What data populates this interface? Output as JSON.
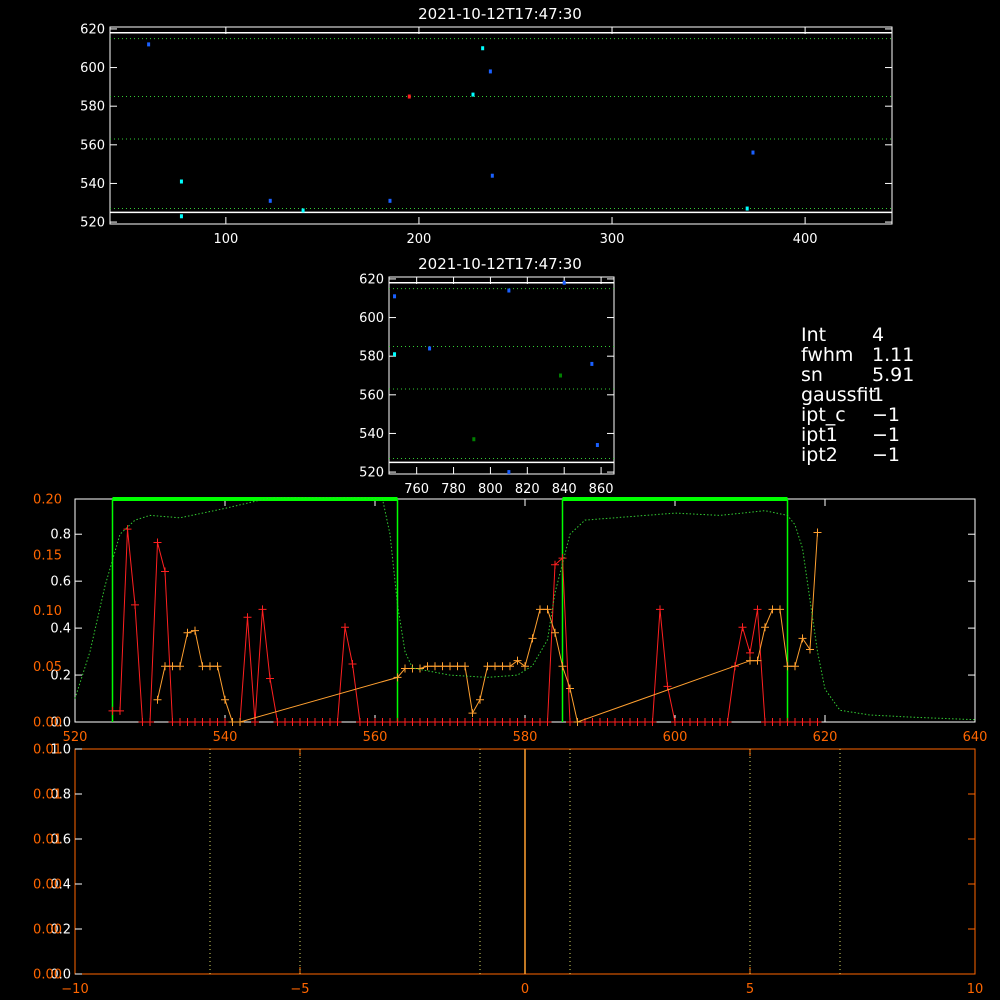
{
  "colors": {
    "background": "#000000",
    "axis": "#ffffff",
    "accent_green": "#00ff00",
    "red": "#ff2020",
    "orange": "#ffa030",
    "cyan": "#00ffff",
    "blue": "#1a60ff",
    "grid_green": "#33cc33",
    "orange_axis": "#ff6600"
  },
  "info": [
    {
      "key": "Int",
      "value": "4"
    },
    {
      "key": "fwhm",
      "value": "1.11"
    },
    {
      "key": "sn",
      "value": "5.91"
    },
    {
      "key": "gaussfit",
      "value": "1"
    },
    {
      "key": "ipt_c",
      "value": "−1"
    },
    {
      "key": "ipt1",
      "value": "−1"
    },
    {
      "key": "ipt2",
      "value": "−1"
    }
  ],
  "chart_data": [
    {
      "type": "scatter",
      "title": "2021-10-12T17:47:30",
      "xlim": [
        40,
        445
      ],
      "ylim": [
        519,
        621
      ],
      "xticks": [
        100,
        200,
        300,
        400
      ],
      "yticks": [
        520,
        540,
        560,
        580,
        600,
        620
      ],
      "hlines_white": [
        618,
        525
      ],
      "hlines_dotted": [
        615,
        585,
        563,
        527
      ],
      "points": [
        {
          "x": 60,
          "y": 612,
          "c": "blue"
        },
        {
          "x": 77,
          "y": 541,
          "c": "cyan"
        },
        {
          "x": 77,
          "y": 523,
          "c": "cyan"
        },
        {
          "x": 123,
          "y": 531,
          "c": "blue"
        },
        {
          "x": 140,
          "y": 526,
          "c": "cyan"
        },
        {
          "x": 185,
          "y": 531,
          "c": "blue"
        },
        {
          "x": 195,
          "y": 585,
          "c": "red"
        },
        {
          "x": 228,
          "y": 586,
          "c": "cyan"
        },
        {
          "x": 233,
          "y": 610,
          "c": "cyan"
        },
        {
          "x": 237,
          "y": 598,
          "c": "blue"
        },
        {
          "x": 238,
          "y": 544,
          "c": "blue"
        },
        {
          "x": 370,
          "y": 527,
          "c": "cyan"
        },
        {
          "x": 373,
          "y": 556,
          "c": "blue"
        }
      ]
    },
    {
      "type": "scatter",
      "title": "2021-10-12T17:47:30",
      "xlim": [
        745,
        867
      ],
      "ylim": [
        519,
        621
      ],
      "xticks": [
        760,
        780,
        800,
        820,
        840,
        860
      ],
      "yticks": [
        520,
        540,
        560,
        580,
        600,
        620
      ],
      "hlines_white": [
        618,
        525
      ],
      "hlines_dotted": [
        615,
        585,
        563,
        527
      ],
      "points": [
        {
          "x": 748,
          "y": 611,
          "c": "blue"
        },
        {
          "x": 748,
          "y": 581,
          "c": "cyan"
        },
        {
          "x": 767,
          "y": 584,
          "c": "blue"
        },
        {
          "x": 791,
          "y": 537,
          "c": "green"
        },
        {
          "x": 810,
          "y": 614,
          "c": "blue"
        },
        {
          "x": 810,
          "y": 520,
          "c": "blue"
        },
        {
          "x": 838,
          "y": 570,
          "c": "green"
        },
        {
          "x": 840,
          "y": 618,
          "c": "blue"
        },
        {
          "x": 855,
          "y": 576,
          "c": "blue"
        },
        {
          "x": 858,
          "y": 534,
          "c": "blue"
        }
      ]
    },
    {
      "type": "line",
      "xlim": [
        520,
        640
      ],
      "xticks": [
        520,
        540,
        560,
        580,
        600,
        620,
        640
      ],
      "ylim_left_white": [
        0,
        0.95
      ],
      "yticks_left_white": [
        0.0,
        0.2,
        0.4,
        0.6,
        0.8
      ],
      "yticks_left_white_labels": [
        "0.0",
        "0.2",
        "0.4",
        "0.6",
        "0.8"
      ],
      "ylim_left_orange": [
        0,
        0.2
      ],
      "yticks_left_orange": [
        0.0,
        0.05,
        0.1,
        0.15,
        0.2
      ],
      "yticks_left_orange_labels": [
        "0.00",
        "0.05",
        "0.10",
        "0.15",
        "0.20"
      ],
      "window_boxes": [
        [
          525,
          563
        ],
        [
          585,
          615
        ]
      ],
      "series": [
        {
          "color": "red",
          "style": "line+plus",
          "x": [
            525,
            526,
            527,
            528,
            529,
            530,
            531,
            532,
            533,
            534,
            535,
            536,
            537,
            538,
            539,
            540,
            541,
            542,
            543,
            544,
            545,
            546,
            547,
            548,
            549,
            550,
            551,
            552,
            553,
            554,
            555,
            556,
            557,
            558,
            559,
            560,
            561,
            562,
            563,
            564,
            565,
            566,
            567,
            568,
            569,
            570,
            571,
            572,
            573,
            574,
            575,
            576,
            577,
            578,
            579,
            580,
            581,
            582,
            583,
            584,
            585,
            586,
            587,
            588,
            589,
            590,
            591,
            592,
            593,
            594,
            595,
            596,
            597,
            598,
            599,
            600,
            601,
            602,
            603,
            604,
            605,
            606,
            607,
            608,
            609,
            610,
            611,
            612,
            613,
            614,
            615,
            616,
            617,
            618,
            619
          ],
          "y": [
            0.01,
            0.01,
            0.173,
            0.105,
            0,
            0,
            0.161,
            0.135,
            0,
            0,
            0,
            0,
            0,
            0,
            0,
            0,
            0,
            0,
            0.094,
            0,
            0.101,
            0.039,
            0,
            0,
            0,
            0,
            0,
            0,
            0,
            0,
            0,
            0.085,
            0.052,
            0,
            0,
            0,
            0,
            0,
            0,
            0,
            0,
            0,
            0,
            0,
            0,
            0,
            0,
            0,
            0,
            0,
            0,
            0,
            0,
            0,
            0,
            0,
            0,
            0,
            0,
            0.141,
            0.147,
            0,
            0,
            0,
            0,
            0,
            0,
            0,
            0,
            0,
            0,
            0,
            0,
            0.101,
            0.032,
            0,
            0,
            0,
            0,
            0,
            0,
            0,
            0,
            0.05,
            0.085,
            0.062,
            0.101,
            0,
            0,
            0,
            0,
            0,
            0,
            0,
            0
          ]
        },
        {
          "color": "orange",
          "style": "line+plus",
          "x": [
            531,
            532,
            533,
            534,
            535,
            536,
            537,
            538,
            539,
            540,
            541,
            542,
            563,
            564,
            565,
            566,
            567,
            568,
            569,
            570,
            571,
            572,
            573,
            574,
            575,
            576,
            577,
            578,
            579,
            580,
            581,
            582,
            583,
            584,
            585,
            586,
            587,
            610,
            611,
            612,
            613,
            614,
            615,
            616,
            617,
            618,
            619
          ],
          "y": [
            0.02,
            0.05,
            0.05,
            0.05,
            0.08,
            0.082,
            0.05,
            0.05,
            0.05,
            0.02,
            0,
            0,
            0.04,
            0.048,
            0.048,
            0.048,
            0.05,
            0.05,
            0.05,
            0.05,
            0.05,
            0.05,
            0.008,
            0.02,
            0.05,
            0.05,
            0.05,
            0.05,
            0.055,
            0.05,
            0.075,
            0.101,
            0.101,
            0.08,
            0.05,
            0.03,
            0,
            0.055,
            0.055,
            0.085,
            0.101,
            0.101,
            0.05,
            0.05,
            0.075,
            0.065,
            0.17
          ]
        },
        {
          "color": "grid_green",
          "style": "dotted",
          "x": [
            520,
            522,
            524,
            526,
            528,
            530,
            534,
            540,
            546,
            552,
            558,
            561,
            562,
            563,
            564,
            565,
            570,
            575,
            579,
            581,
            583,
            584,
            586,
            588,
            592,
            600,
            606,
            612,
            615,
            616,
            617,
            618,
            619,
            620,
            622,
            626,
            632,
            640
          ],
          "y": [
            0.1,
            0.3,
            0.58,
            0.8,
            0.86,
            0.88,
            0.87,
            0.91,
            0.955,
            0.955,
            0.955,
            0.95,
            0.8,
            0.5,
            0.3,
            0.23,
            0.2,
            0.19,
            0.2,
            0.24,
            0.35,
            0.55,
            0.8,
            0.86,
            0.87,
            0.89,
            0.88,
            0.9,
            0.88,
            0.84,
            0.74,
            0.52,
            0.3,
            0.14,
            0.05,
            0.03,
            0.02,
            0.01
          ]
        }
      ]
    },
    {
      "type": "line",
      "xlim": [
        -10,
        10
      ],
      "xticks": [
        -10,
        -5,
        0,
        5,
        10
      ],
      "ylim_left_white": [
        0,
        1.0
      ],
      "yticks_left_white": [
        0.0,
        0.2,
        0.4,
        0.6,
        0.8,
        1.0
      ],
      "yticks_left_white_labels": [
        "0.0",
        "0.2",
        "0.4",
        "0.6",
        "0.8",
        "1.0"
      ],
      "ylim_left_orange": [
        0,
        0.01
      ],
      "yticks_left_orange": [
        0.0,
        0.002,
        0.004,
        0.006,
        0.008,
        0.01
      ],
      "yticks_left_orange_labels": [
        "0.00",
        "0.00",
        "0.00",
        "0.01",
        "0.01",
        "0.01"
      ],
      "vlines_dotted": [
        -7,
        -5,
        -1,
        1,
        5,
        7
      ],
      "vline_solid": 0
    }
  ]
}
